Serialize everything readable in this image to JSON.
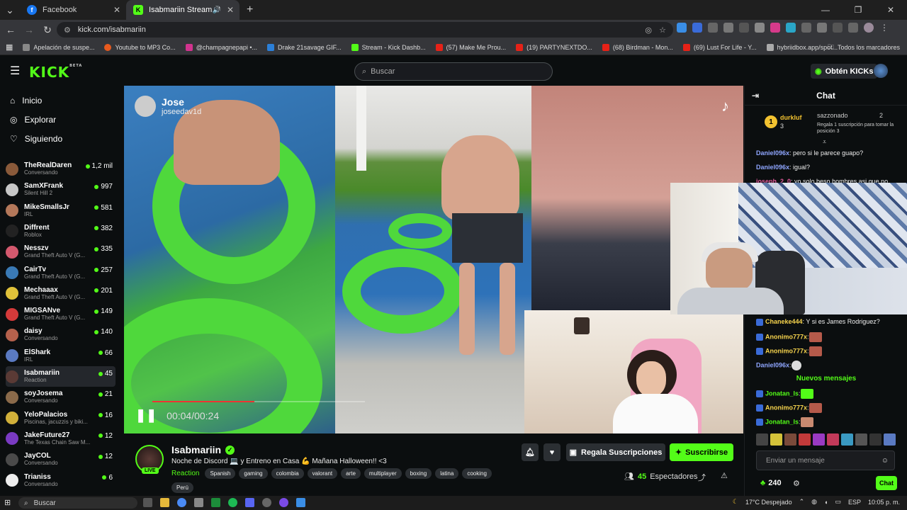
{
  "browser": {
    "tabs": [
      {
        "title": "Facebook",
        "favicon_color": "#1877f2",
        "favicon_glyph": "f"
      },
      {
        "title": "Isabmariin Stream - Watch",
        "favicon_color": "#53fc18",
        "favicon_glyph": "K"
      }
    ],
    "new_tab": "+",
    "url": "kick.com/isabmariin",
    "bookmarks": [
      {
        "label": "Apelación de suspe...",
        "color": "#888"
      },
      {
        "label": "Youtube to MP3 Co...",
        "color": "#e85a1e"
      },
      {
        "label": "@champagnepapi •...",
        "color": "#d1338e"
      },
      {
        "label": "Drake 21savage GIF...",
        "color": "#2b7fd8"
      },
      {
        "label": "Stream - Kick Dashb...",
        "color": "#53fc18"
      },
      {
        "label": "(57) Make Me Prou...",
        "color": "#e62117"
      },
      {
        "label": "(19) PARTYNEXTDO...",
        "color": "#e62117"
      },
      {
        "label": "(68) Birdman - Mon...",
        "color": "#e62117"
      },
      {
        "label": "(69) Lust For Life - Y...",
        "color": "#e62117"
      },
      {
        "label": "hybriidbox.app/spot...",
        "color": "#aaa"
      }
    ],
    "all_bookmarks": "Todos los marcadores"
  },
  "kick": {
    "logo": "KICK",
    "logo_sup": "BETA",
    "search_placeholder": "Buscar",
    "get_kicks": "Obtén KICKs",
    "accent": "#53fc18"
  },
  "sidebar": {
    "nav": [
      {
        "label": "Inicio",
        "icon": "home-icon"
      },
      {
        "label": "Explorar",
        "icon": "compass-icon"
      },
      {
        "label": "Siguiendo",
        "icon": "heart-icon"
      }
    ],
    "channels": [
      {
        "name": "TheRealDaren",
        "sub": "Conversando",
        "viewers": "1,2 mil",
        "color": "#8a5a3a"
      },
      {
        "name": "SamXFrank",
        "sub": "Silent Hill 2",
        "viewers": "997",
        "color": "#c7c7c7"
      },
      {
        "name": "MikeSmallsJr",
        "sub": "IRL",
        "viewers": "581",
        "color": "#b4785a"
      },
      {
        "name": "Diffrent",
        "sub": "Roblox",
        "viewers": "382",
        "color": "#222"
      },
      {
        "name": "Nesszv",
        "sub": "Grand Theft Auto V (G...",
        "viewers": "335",
        "color": "#d4596e"
      },
      {
        "name": "CairTv",
        "sub": "Grand Theft Auto V (G...",
        "viewers": "257",
        "color": "#3a7ab5"
      },
      {
        "name": "Mechaaax",
        "sub": "Grand Theft Auto V (G...",
        "viewers": "201",
        "color": "#e0c23a"
      },
      {
        "name": "MIGSANve",
        "sub": "Grand Theft Auto V (G...",
        "viewers": "149",
        "color": "#d43a3a"
      },
      {
        "name": "daisy",
        "sub": "Conversando",
        "viewers": "140",
        "color": "#b5614c"
      },
      {
        "name": "ElShark",
        "sub": "IRL",
        "viewers": "66",
        "color": "#5a7ac2"
      },
      {
        "name": "Isabmariin",
        "sub": "Reaction",
        "viewers": "45",
        "color": "#5a3a35"
      },
      {
        "name": "soyJosema",
        "sub": "Conversando",
        "viewers": "21",
        "color": "#8a6a4a"
      },
      {
        "name": "YeloPalacios",
        "sub": "Piscinas, jacuzzis y biki...",
        "viewers": "16",
        "color": "#d1b03a"
      },
      {
        "name": "JakeFuture27",
        "sub": "The Texas Chain Saw M...",
        "viewers": "12",
        "color": "#7a3ac2"
      },
      {
        "name": "JayCOL",
        "sub": "Conversando",
        "viewers": "12",
        "color": "#4a4a4a"
      },
      {
        "name": "Trianiss",
        "sub": "Conversando",
        "viewers": "6",
        "color": "#eee"
      }
    ]
  },
  "video": {
    "tiktok_user": "Jose",
    "tiktok_handle": "joseedav1d",
    "time": "00:04/00:24",
    "progress": 0.48
  },
  "stream": {
    "name": "Isabmariin",
    "live": "LIVE",
    "title": "Noche de Discord 💻 y Entreno en Casa 💪 Mañana Halloween!! <3",
    "category": "Reaction",
    "tags": [
      "Spanish",
      "gaming",
      "colombia",
      "valorant",
      "arte",
      "multiplayer",
      "boxing",
      "latina",
      "cooking"
    ],
    "tag_extra": "Perú",
    "gift_label": "Regala Suscripciones",
    "subscribe_label": "Suscribirse",
    "viewers_count": "45",
    "viewers_label": "Espectadores"
  },
  "chat": {
    "title": "Chat",
    "pinned": {
      "user": "durkluf",
      "rank": "1",
      "count": "3",
      "gift_user": "sazzonado",
      "gift_count": "2",
      "gift_text": "Regala 1 suscripción para tomar la posición 3"
    },
    "messages_top": [
      {
        "user": "Daniel096x",
        "text": ": pero si le parece guapo?"
      },
      {
        "user": "Daniel096x",
        "text": ": igual?"
      },
      {
        "user": "joseph_2_0",
        "text": ": yo solo beso hombres asi que no"
      }
    ],
    "messages_mid": [
      {
        "user": "Chaneke444",
        "text": ": Y si es James Rodriguez?"
      },
      {
        "user": "Anonimo777x",
        "text": ":"
      },
      {
        "user": "Anonimo777x",
        "text": ":"
      },
      {
        "user": "Daniel096x",
        "text": ":"
      }
    ],
    "new_messages": "Nuevos mensajes",
    "messages_new": [
      {
        "user": "Jonatan_ls",
        "text": ":"
      },
      {
        "user": "Anonimo777x",
        "text": ":"
      },
      {
        "user": "Jonatan_ls",
        "text": ":"
      }
    ],
    "input_placeholder": "Enviar un mensaje",
    "points": "240",
    "send_label": "Chat"
  },
  "taskbar": {
    "search": "Buscar",
    "weather": "17°C  Despejado",
    "lang": "ESP",
    "time": "10:05 p. m."
  }
}
